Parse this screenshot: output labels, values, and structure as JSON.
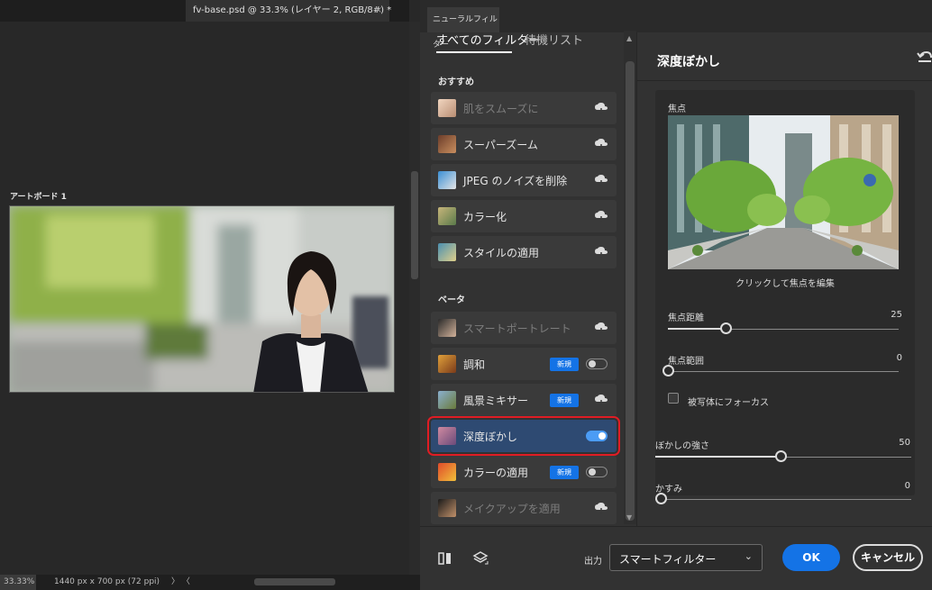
{
  "document": {
    "tab_title": "fv-base.psd @ 33.3% (レイヤー 2, RGB/8#) *",
    "tab_close": "×",
    "artboard_label": "アートボード 1"
  },
  "status_bar": {
    "zoom": "33.33%",
    "dimensions": "1440 px x 700 px (72 ppi)",
    "arrow": "〉 〈"
  },
  "neural_filters": {
    "window_tab": "ニューラルフィルター",
    "tabs": {
      "all_filters": "すべてのフィルター",
      "waitlist": "待機リスト"
    },
    "sections": {
      "featured": "おすすめ",
      "beta": "ベータ"
    },
    "featured_filters": [
      {
        "label": "肌をスムーズに",
        "disabled": true,
        "icon": "cloud-download-icon"
      },
      {
        "label": "スーパーズーム",
        "disabled": false,
        "icon": "cloud-download-icon"
      },
      {
        "label": "JPEG のノイズを削除",
        "disabled": false,
        "icon": "cloud-download-icon"
      },
      {
        "label": "カラー化",
        "disabled": false,
        "icon": "cloud-download-icon"
      },
      {
        "label": "スタイルの適用",
        "disabled": false,
        "icon": "cloud-download-icon"
      }
    ],
    "beta_filters": [
      {
        "label": "スマートポートレート",
        "disabled": true,
        "icon": "cloud-download-icon"
      },
      {
        "label": "調和",
        "badge": "新規",
        "toggle": false
      },
      {
        "label": "風景ミキサー",
        "badge": "新規",
        "icon": "cloud-download-icon"
      },
      {
        "label": "深度ぼかし",
        "toggle": true,
        "selected": true
      },
      {
        "label": "カラーの適用",
        "badge": "新規",
        "toggle": false
      },
      {
        "label": "メイクアップを適用",
        "disabled": true,
        "icon": "cloud-download-icon"
      }
    ],
    "settings": {
      "title": "深度ぼかし",
      "focus_label": "焦点",
      "focus_caption": "クリックして焦点を編集",
      "focal_distance": {
        "label": "焦点距離",
        "value": 25
      },
      "focal_range": {
        "label": "焦点範囲",
        "value": 0
      },
      "focus_subject": {
        "label": "被写体にフォーカス",
        "checked": false
      },
      "blur_strength": {
        "label": "ぼかしの強さ",
        "value": 50
      },
      "haze": {
        "label": "かすみ",
        "value": 0
      }
    },
    "footer": {
      "output_label": "出力",
      "output_value": "スマートフィルター",
      "ok": "OK",
      "cancel": "キャンセル"
    }
  },
  "colors": {
    "accent_blue": "#1473e6",
    "selection_outline": "#e01c24",
    "panel_bg": "#323232"
  }
}
